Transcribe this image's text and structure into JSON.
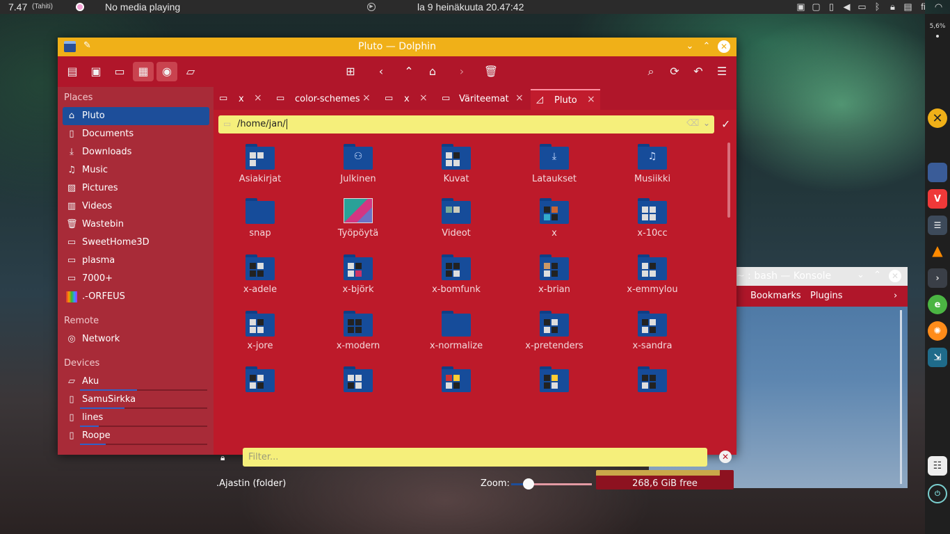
{
  "top_panel": {
    "clock": "7.47",
    "timezone": "(Tahiti)",
    "media_status": "No media playing",
    "date": "la 9 heinäkuuta 20.47:42",
    "tray_icons": [
      "media-icon",
      "display-icon",
      "phone-icon",
      "volume-icon",
      "monitor-icon",
      "bluetooth-icon",
      "lock-icon",
      "clipboard-icon",
      "keyboard-layout-icon",
      "wifi-icon",
      "expand-icon"
    ],
    "keyboard_layout": "fi"
  },
  "dock": {
    "cpu": "5,6%",
    "items": [
      "close-app",
      "file-manager",
      "vivaldi",
      "settings",
      "vlc",
      "terminal",
      "editor",
      "orange-app",
      "kdenlive",
      "notes",
      "power"
    ]
  },
  "dolphin": {
    "title": "Pluto — Dolphin",
    "places_header": "Places",
    "places": [
      "Pluto",
      "Documents",
      "Downloads",
      "Music",
      "Pictures",
      "Videos",
      "Wastebin",
      "SweetHome3D",
      "plasma",
      "7000+",
      ".-ORFEUS"
    ],
    "remote_header": "Remote",
    "remote": [
      "Network"
    ],
    "devices_header": "Devices",
    "devices": [
      {
        "label": "Aku",
        "usage": 0.45
      },
      {
        "label": "SamuSirkka",
        "usage": 0.35
      },
      {
        "label": "lines",
        "usage": 0.15
      },
      {
        "label": "Roope",
        "usage": 0.2
      }
    ],
    "tabs": [
      "x",
      "color-schemes",
      "x",
      "Väriteemat",
      "Pluto"
    ],
    "location": "/home/jan/",
    "files": [
      "Asiakirjat",
      "Julkinen",
      "Kuvat",
      "Lataukset",
      "Musiikki",
      "snap",
      "Työpöytä",
      "Videot",
      "x",
      "x-10cc",
      "x-adele",
      "x-björk",
      "x-bomfunk",
      "x-brian",
      "x-emmylou",
      "x-jore",
      "x-modern",
      "x-normalize",
      "x-pretenders",
      "x-sandra",
      "",
      "",
      "",
      "",
      ""
    ],
    "filter_placeholder": "Filter...",
    "status_info": ".Ajastin (folder)",
    "zoom_label": "Zoom:",
    "zoom_level": 0.2,
    "free_space": "268,6 GiB free",
    "disk_usage": 0.9
  },
  "konsole": {
    "title": "~ : bash — Konsole",
    "menu": [
      "Bookmarks",
      "Plugins"
    ]
  },
  "colors": {
    "accent": "#1d4e9a",
    "window_bg": "#b0162a",
    "titlebar": "#f0b018",
    "field": "#f5ef7b"
  }
}
